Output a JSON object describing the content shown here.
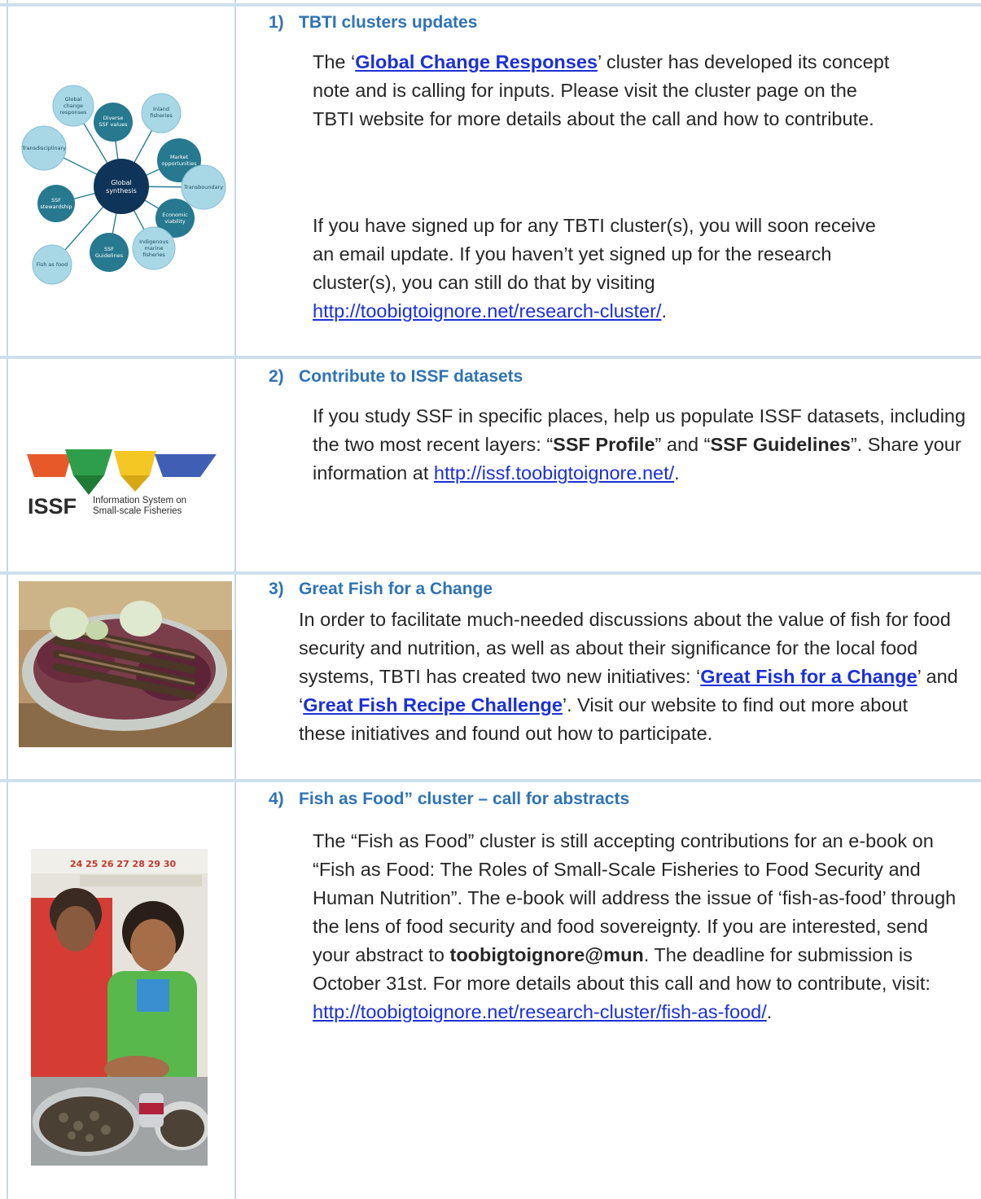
{
  "sections": [
    {
      "number": "1)",
      "title": "TBTI clusters updates",
      "diagram": {
        "center": "Global synthesis",
        "nodes": [
          "Diverse SSF values",
          "Inland fisheries",
          "Market opportunities",
          "Transboundary",
          "Economic viability",
          "Indigenous marine fisheries",
          "SSF Guidelines",
          "Fish as food",
          "SSF stewardship",
          "Transdisciplinary",
          "Global change responses"
        ]
      },
      "p1_before": "The ‘",
      "p1_link": "Global Change Responses",
      "p1_after": "’ cluster has developed its concept note and is calling for inputs. Please visit the cluster page on the TBTI website for more details about the call and how to contribute.",
      "p2_text": "If you have signed up for any TBTI cluster(s), you will soon receive an email update. If you haven’t yet signed up for the research cluster(s), you can still do that by visiting ",
      "p2_link": "http://toobigtoignore.net/research-cluster/",
      "p2_end": "."
    },
    {
      "number": "2)",
      "title": "Contribute to ISSF datasets",
      "logo_word": "ISSF",
      "logo_line1": "Information System on",
      "logo_line2": "Small-scale Fisheries",
      "p1_a": "If you study SSF in specific places, help us populate ISSF datasets, including the two most recent layers: “",
      "p1_b1": "SSF Profile",
      "p1_c": "” and “",
      "p1_b2": "SSF Guidelines",
      "p1_d": "”. Share your information at ",
      "p1_link": "http://issf.toobigtoignore.net/",
      "p1_end": "."
    },
    {
      "number": "3)",
      "title": "Great Fish for a Change",
      "p1_a": "In order to facilitate much-needed discussions about the value of fish for food security and nutrition, as well as about their significance for the local food systems, TBTI has created two new initiatives: ‘",
      "p1_link1": "Great Fish for a Change",
      "p1_b": "’ and ‘",
      "p1_link2": "Great Fish Recipe Challenge",
      "p1_c": "’. Visit our website to find out more about these initiatives and found out how to participate."
    },
    {
      "number": "4)",
      "title": "Fish as Food” cluster – call for abstracts",
      "calendar": "24 25 26 27 28 29 30",
      "p1_a": "The “Fish as Food” cluster is still accepting contributions for an e-book on “Fish as Food: The Roles of Small-Scale Fisheries to Food Security and Human Nutrition”. The e-book will address the issue of ‘fish-as-food’ through the lens of food security and food sovereignty. If you are interested, send your abstract to ",
      "p1_email": "toobigtoignore@mun",
      "p1_b": ". The deadline for submission is October 31st. For more details about this call and how to contribute, visit: ",
      "p1_link": "http://toobigtoignore.net/research-cluster/fish-as-food/",
      "p1_end": "."
    }
  ]
}
